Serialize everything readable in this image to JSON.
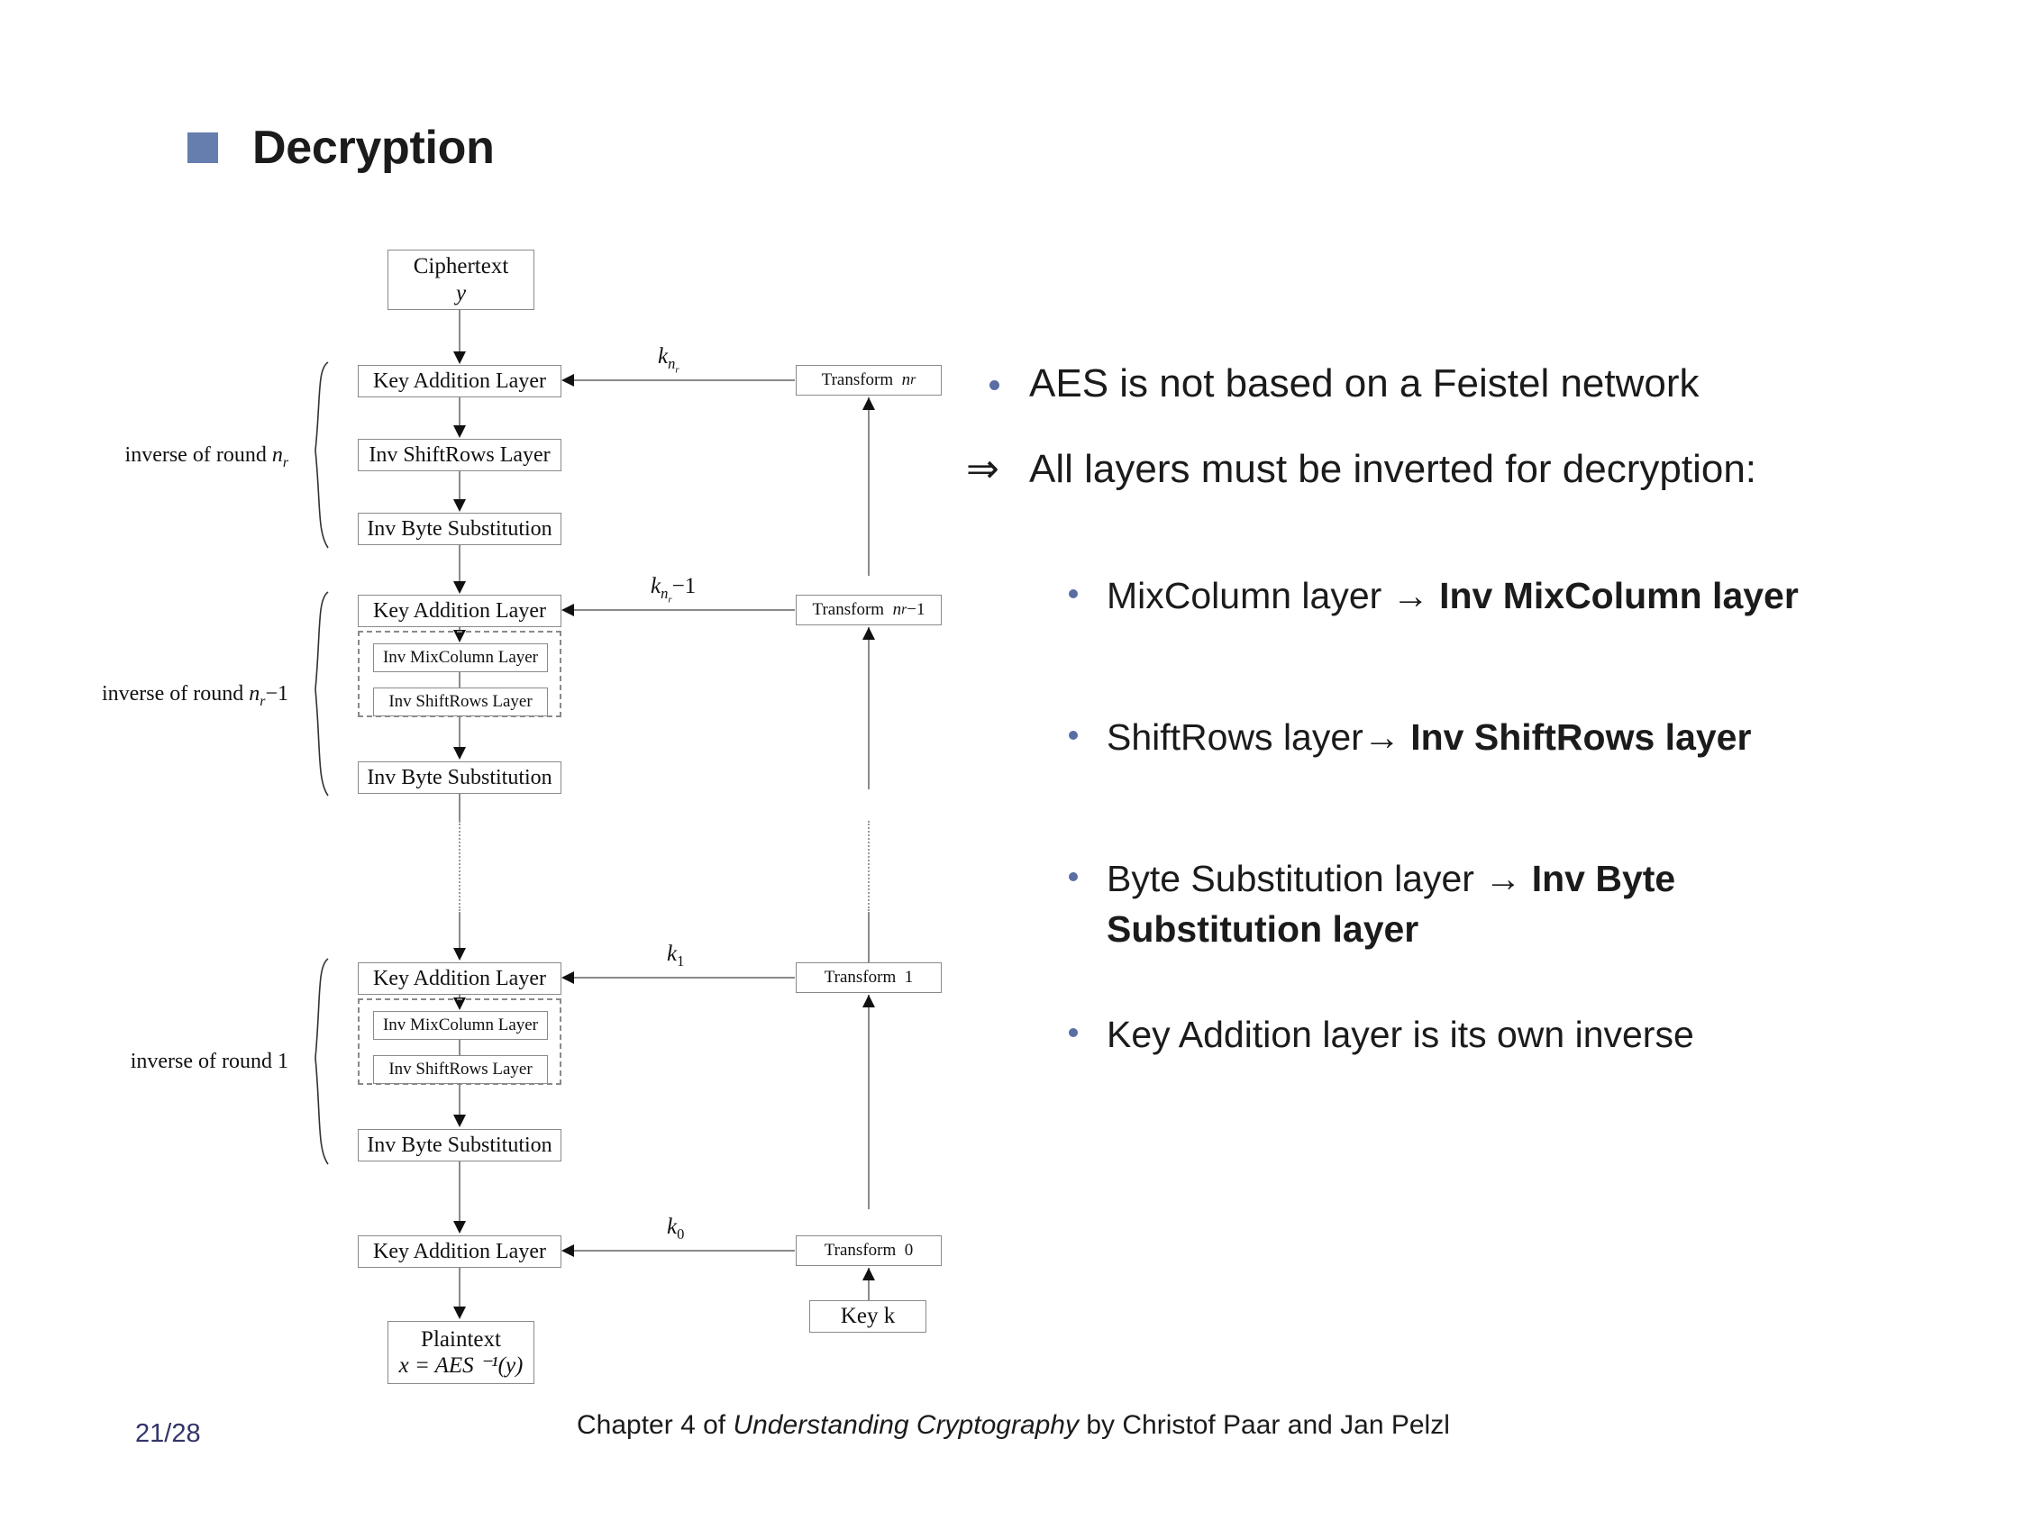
{
  "slide": {
    "title": "Decryption",
    "title_bullet_color": "#667eae",
    "accent_color": "#5a6ea3",
    "page_number": "21/28",
    "footer_prefix": "Chapter 4 of ",
    "footer_italic": "Understanding Cryptography",
    "footer_suffix": " by Christof Paar and Jan Pelzl"
  },
  "diagram": {
    "ciphertext_box": {
      "line1": "Ciphertext",
      "line2": "y"
    },
    "plaintext_box": {
      "line1": "Plaintext",
      "line2": "x = AES ⁻¹(y)"
    },
    "key_box": "Key  k",
    "round_nr": {
      "label_prefix": "inverse of round  ",
      "label_value": "n",
      "label_sub": "r",
      "label_suffix": "",
      "key_label_base": "k",
      "key_label_sub": "n",
      "key_label_subsub": "r",
      "key_label_suffix": "",
      "transform_label": "Transform",
      "transform_value": "n",
      "transform_sub": "r",
      "transform_suffix": "",
      "layers": [
        "Key Addition Layer",
        "Inv ShiftRows Layer",
        "Inv Byte Substitution"
      ]
    },
    "round_nr_minus_1": {
      "label_prefix": "inverse of round  ",
      "label_value": "n",
      "label_sub": "r",
      "label_suffix": "−1",
      "key_label_base": "k",
      "key_label_sub": "n",
      "key_label_subsub": "r",
      "key_label_suffix": "−1",
      "transform_label": "Transform",
      "transform_value": "n",
      "transform_sub": "r",
      "transform_suffix": "−1",
      "key_addition": "Key Addition Layer",
      "dashed_layers": [
        "Inv MixColumn Layer",
        "Inv ShiftRows Layer"
      ],
      "byte_sub": "Inv Byte Substitution"
    },
    "round_1": {
      "label_prefix": "inverse of round 1",
      "key_label_base": "k",
      "key_label_sub": "1",
      "transform_label": "Transform",
      "transform_value": "1",
      "key_addition": "Key Addition Layer",
      "dashed_layers": [
        "Inv MixColumn Layer",
        "Inv ShiftRows Layer"
      ],
      "byte_sub": "Inv Byte Substitution"
    },
    "round_0": {
      "key_label_base": "k",
      "key_label_sub": "0",
      "transform_label": "Transform",
      "transform_value": "0",
      "key_addition": "Key Addition Layer"
    }
  },
  "bullets": {
    "main_1": "AES is not based on a Feistel network",
    "implication_symbol": "⇒",
    "main_2": "All layers must be inverted for decryption:",
    "sub": [
      {
        "plain": "MixColumn layer → ",
        "bold": "Inv MixColumn layer"
      },
      {
        "plain": "ShiftRows layer→ ",
        "bold": "Inv ShiftRows layer"
      },
      {
        "plain": "Byte Substitution layer → ",
        "bold": "Inv Byte Substitution layer"
      },
      {
        "plain": "Key Addition layer is its own inverse",
        "bold": ""
      }
    ]
  }
}
